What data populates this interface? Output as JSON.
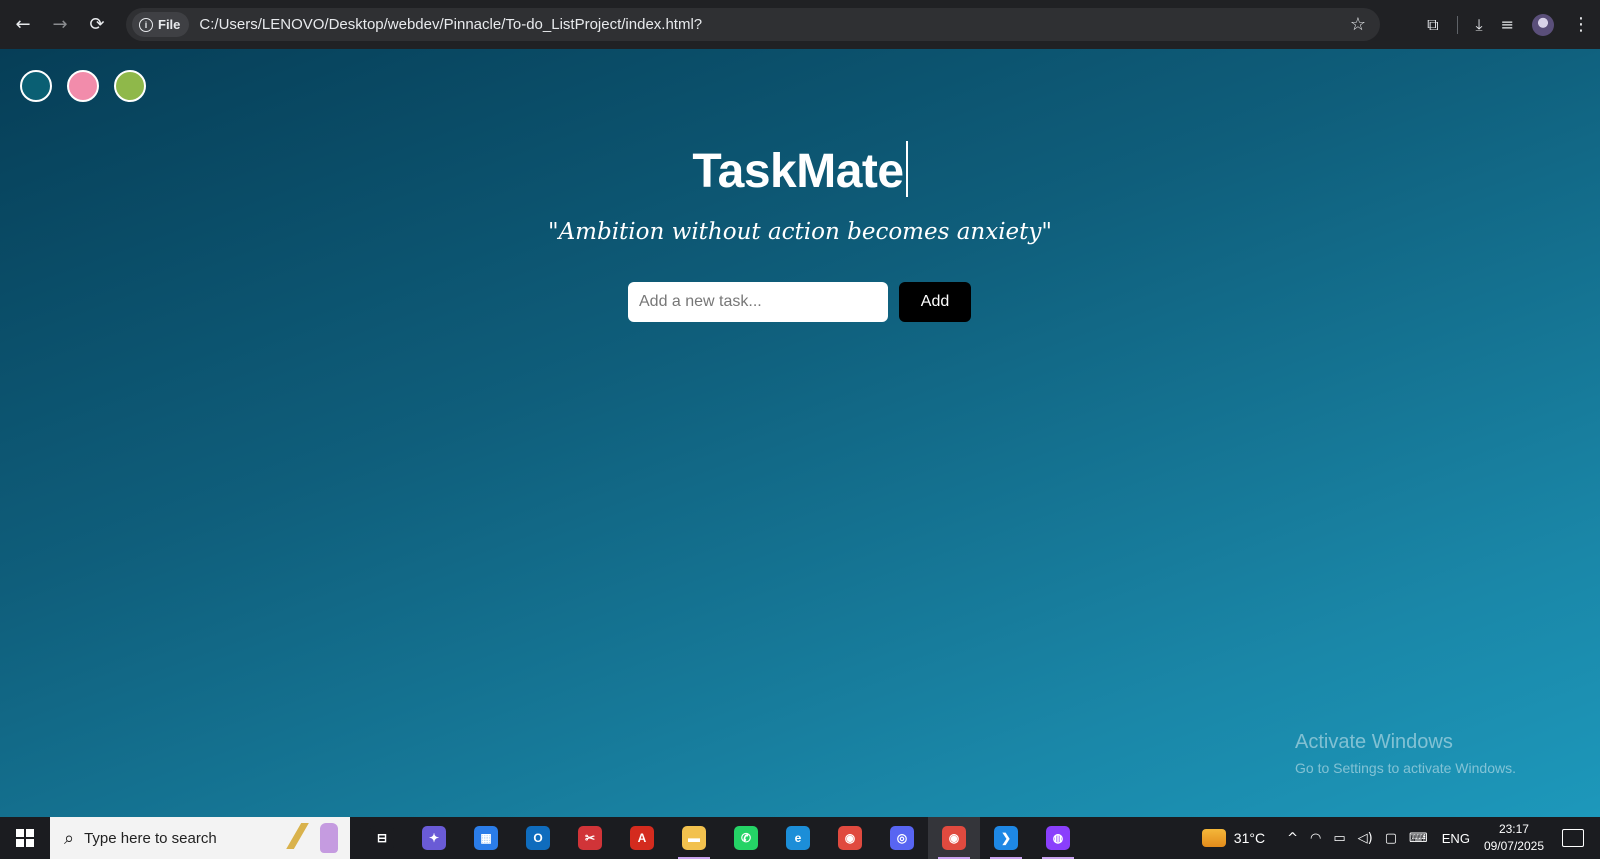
{
  "browser": {
    "back_glyph": "←",
    "forward_glyph": "→",
    "reload_glyph": "⟳",
    "chip_label": "File",
    "info_glyph": "i",
    "url": "C:/Users/LENOVO/Desktop/webdev/Pinnacle/To-do_ListProject/index.html?",
    "star_glyph": "☆",
    "extensions_glyph": "⧉",
    "download_glyph": "⤓",
    "media_glyph": "≡",
    "menu_glyph": "⋮"
  },
  "theme_colors": [
    "#0a5f73",
    "#f28cab",
    "#8fb84a"
  ],
  "app": {
    "title": "TaskMate",
    "quote": "\"Ambition without action becomes anxiety\"",
    "input_placeholder": "Add a new task...",
    "add_label": "Add"
  },
  "watermark": {
    "title": "Activate Windows",
    "subtitle": "Go to Settings to activate Windows."
  },
  "taskbar": {
    "search_placeholder": "Type here to search",
    "search_glyph": "⌕",
    "apps": [
      {
        "name": "task-view",
        "glyph": "⊟",
        "color": "#1b1c20"
      },
      {
        "name": "copilot",
        "glyph": "✦",
        "color": "#6a5bd6"
      },
      {
        "name": "microsoft-store",
        "glyph": "▦",
        "color": "#2b7de9"
      },
      {
        "name": "outlook",
        "glyph": "O",
        "color": "#0f6cbd"
      },
      {
        "name": "snipping-tool",
        "glyph": "✂",
        "color": "#d13438"
      },
      {
        "name": "acrobat",
        "glyph": "A",
        "color": "#d42b1e"
      },
      {
        "name": "file-explorer",
        "glyph": "▬",
        "color": "#f2c14e"
      },
      {
        "name": "whatsapp",
        "glyph": "✆",
        "color": "#25d366"
      },
      {
        "name": "edge",
        "glyph": "e",
        "color": "#1c8ed8"
      },
      {
        "name": "chrome",
        "glyph": "◉",
        "color": "#e04a3f"
      },
      {
        "name": "discord",
        "glyph": "◎",
        "color": "#5865f2"
      },
      {
        "name": "chrome-profile",
        "glyph": "◉",
        "color": "#e04a3f"
      },
      {
        "name": "vscode",
        "glyph": "❯",
        "color": "#1e88e5"
      },
      {
        "name": "github-desktop",
        "glyph": "◍",
        "color": "#8a3ffc"
      }
    ],
    "active_app_index": 11,
    "underlined_indices": [
      6,
      11,
      12,
      13
    ],
    "temperature": "31°C",
    "tray_glyphs": [
      "^",
      "◠",
      "▭",
      "◁)",
      "▢",
      "⌨"
    ],
    "language": "ENG",
    "time": "23:17",
    "date": "09/07/2025"
  }
}
